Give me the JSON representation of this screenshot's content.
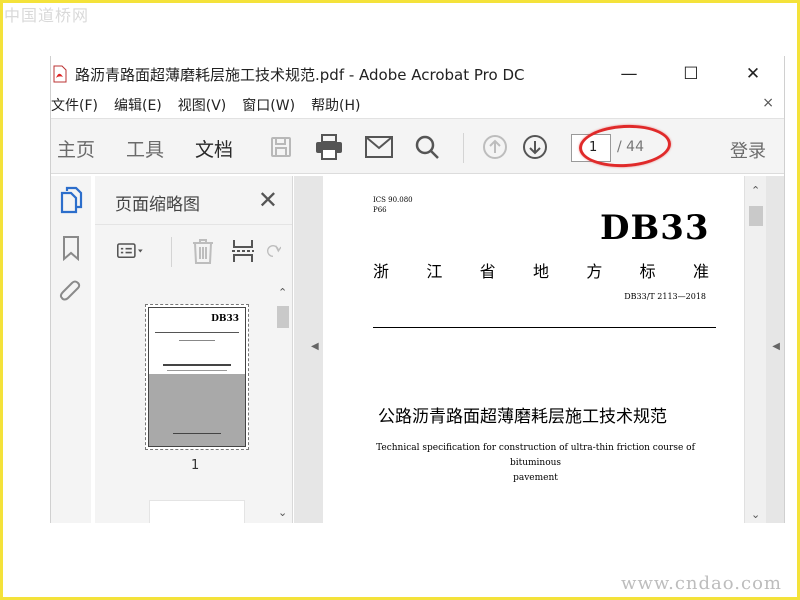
{
  "watermark": {
    "top": "中国道桥网",
    "bottom": "www.cndao.com"
  },
  "window": {
    "title": "路沥青路面超薄磨耗层施工技术规范.pdf - Adobe Acrobat Pro DC",
    "controls": {
      "minimize": "—",
      "maximize": "☐",
      "close": "✕"
    }
  },
  "menu": {
    "items": [
      "文件(F)",
      "编辑(E)",
      "视图(V)",
      "窗口(W)",
      "帮助(H)"
    ],
    "close": "×"
  },
  "toolbar": {
    "tabs": [
      "主页",
      "工具",
      "文档"
    ],
    "active_tab": "文档",
    "page_current": "1",
    "page_total": "/ 44",
    "login": "登录"
  },
  "thumbnails": {
    "title": "页面缩略图",
    "close": "✕",
    "page_label": "1",
    "preview": {
      "code": "DB33"
    }
  },
  "document": {
    "ics": "ICS 90.080",
    "p": "P66",
    "std_code_big": "DB33",
    "std_name_chars": [
      "浙",
      "江",
      "省",
      "地",
      "方",
      "标",
      "准"
    ],
    "std_number": "DB33/T 2113—2018",
    "title_cn": "公路沥青路面超薄磨耗层施工技术规范",
    "title_en_line1": "Technical specification for construction of ultra-thin friction course of bituminous",
    "title_en_line2": "pavement"
  },
  "colors": {
    "frame": "#f4e23a",
    "highlight_ellipse": "#e02a2a",
    "toolbar_bg": "#f4f4f4",
    "accent_blue": "#2c6ecb"
  }
}
